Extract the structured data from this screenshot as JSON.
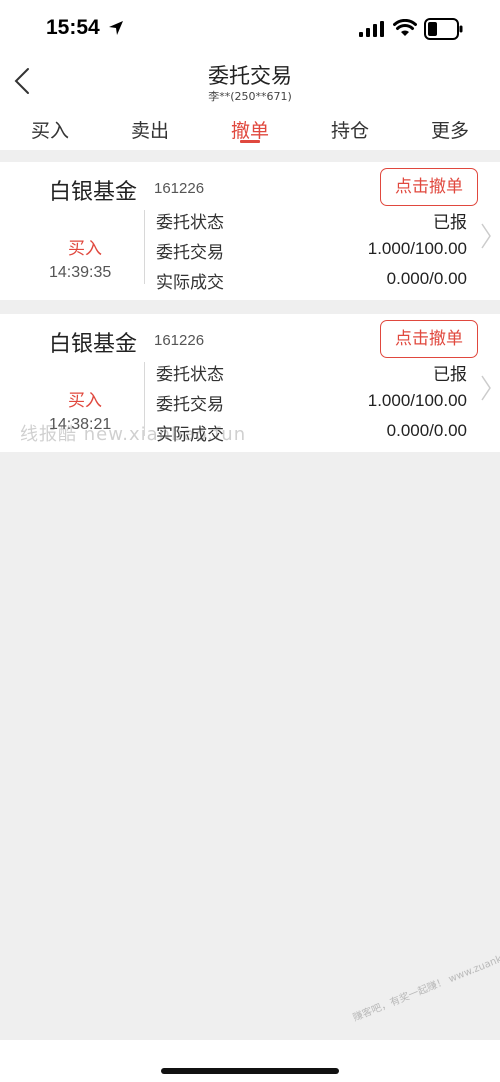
{
  "status": {
    "time": "15:54"
  },
  "header": {
    "title": "委托交易",
    "subtitle": "李**(250**671)",
    "back_icon": "chevron-left-icon"
  },
  "tabs": [
    {
      "label": "买入",
      "active": false
    },
    {
      "label": "卖出",
      "active": false
    },
    {
      "label": "撤单",
      "active": true
    },
    {
      "label": "持仓",
      "active": false
    },
    {
      "label": "更多",
      "active": false
    }
  ],
  "orders": [
    {
      "name": "白银基金",
      "code": "161226",
      "side": "买入",
      "time": "14:39:35",
      "cancel_label": "点击撤单",
      "rows": [
        {
          "label": "委托状态",
          "value": "已报"
        },
        {
          "label": "委托交易",
          "value": "1.000/100.00"
        },
        {
          "label": "实际成交",
          "value": "0.000/0.00"
        }
      ]
    },
    {
      "name": "白银基金",
      "code": "161226",
      "side": "买入",
      "time": "14:38:21",
      "cancel_label": "点击撤单",
      "rows": [
        {
          "label": "委托状态",
          "value": "已报"
        },
        {
          "label": "委托交易",
          "value": "1.000/100.00"
        },
        {
          "label": "实际成交",
          "value": "0.000/0.00"
        }
      ]
    }
  ],
  "watermark": {
    "text": "线报酷 new.xianbao.fun",
    "corner_text": "赚客吧，有奖一起赚！ www.zuanke8.com"
  },
  "colors": {
    "accent": "#e0483e",
    "background": "#efefef"
  }
}
